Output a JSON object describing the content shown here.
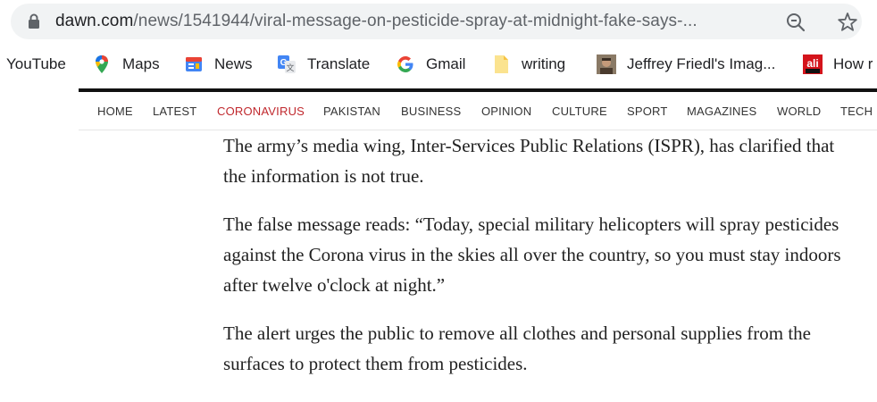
{
  "browser": {
    "url_host": "dawn.com",
    "url_path": "/news/1541944/viral-message-on-pesticide-spray-at-midnight-fake-says-...",
    "icons": [
      "lock-icon",
      "zoom-icon",
      "star-icon"
    ]
  },
  "bookmarks": [
    {
      "label": "YouTube",
      "icon": "none"
    },
    {
      "label": "Maps",
      "icon": "maps-icon"
    },
    {
      "label": "News",
      "icon": "news-icon"
    },
    {
      "label": "Translate",
      "icon": "translate-icon"
    },
    {
      "label": "Gmail",
      "icon": "google-icon"
    },
    {
      "label": "writing",
      "icon": "folder-doc-icon"
    },
    {
      "label": "Jeffrey Friedl's Imag...",
      "icon": "avatar-icon"
    },
    {
      "label": "How r",
      "icon": "ali-news-icon"
    }
  ],
  "nav": {
    "items": [
      "HOME",
      "LATEST",
      "CORONAVIRUS",
      "PAKISTAN",
      "BUSINESS",
      "OPINION",
      "CULTURE",
      "SPORT",
      "MAGAZINES",
      "WORLD",
      "TECH"
    ],
    "active": "CORONAVIRUS",
    "active_color": "#c0282d"
  },
  "article": {
    "paragraphs": [
      "The army’s media wing, Inter-Services Public Relations (ISPR), has clarified that the information is not true.",
      "The false message reads: “Today, special military helicopters will spray pesticides against the Corona virus in the skies all over the country, so you must stay indoors after twelve o'clock at night.”",
      "The alert urges the public to remove all clothes and personal supplies from the surfaces to protect them from pesticides."
    ]
  }
}
